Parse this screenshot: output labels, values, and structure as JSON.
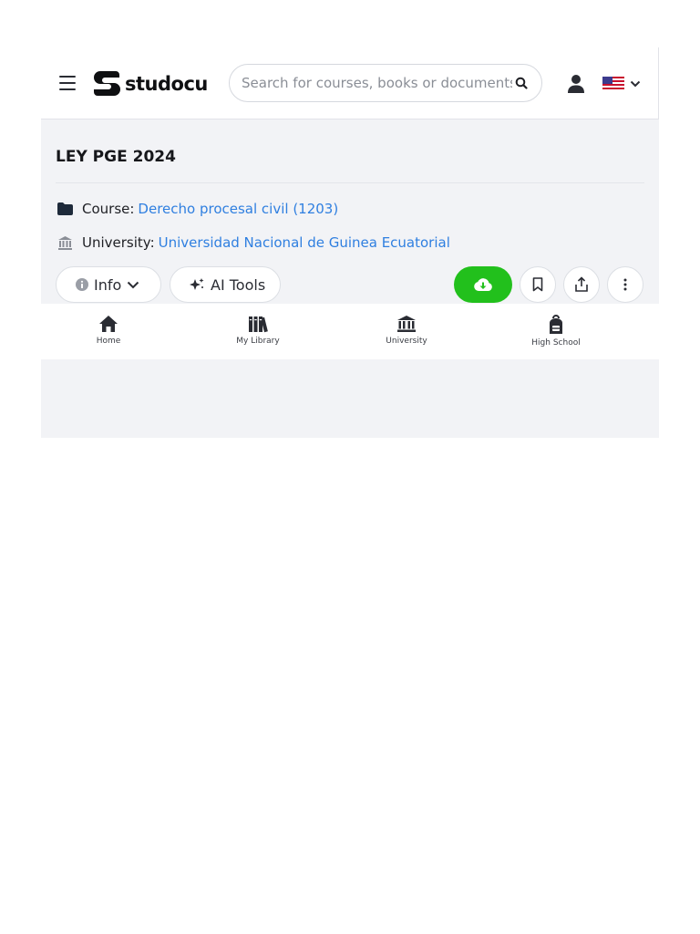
{
  "header": {
    "logo_text": "studocu",
    "search_placeholder": "Search for courses, books or documents"
  },
  "document": {
    "title": "LEY PGE 2024",
    "course_label": "Course:",
    "course_value": "Derecho procesal civil (1203)",
    "university_label": "University:",
    "university_value": "Universidad Nacional de Guinea Ecuatorial"
  },
  "actions": {
    "info_label": "Info",
    "ai_tools_label": "AI Tools"
  },
  "bottom_nav": {
    "items": [
      {
        "label": "Home",
        "icon": "home-icon"
      },
      {
        "label": "My Library",
        "icon": "library-icon"
      },
      {
        "label": "University",
        "icon": "university-icon"
      },
      {
        "label": "High School",
        "icon": "backpack-icon"
      }
    ]
  },
  "colors": {
    "accent_link": "#2f7fe0",
    "download_green": "#22c01c",
    "panel_bg": "#f2f3f6"
  }
}
